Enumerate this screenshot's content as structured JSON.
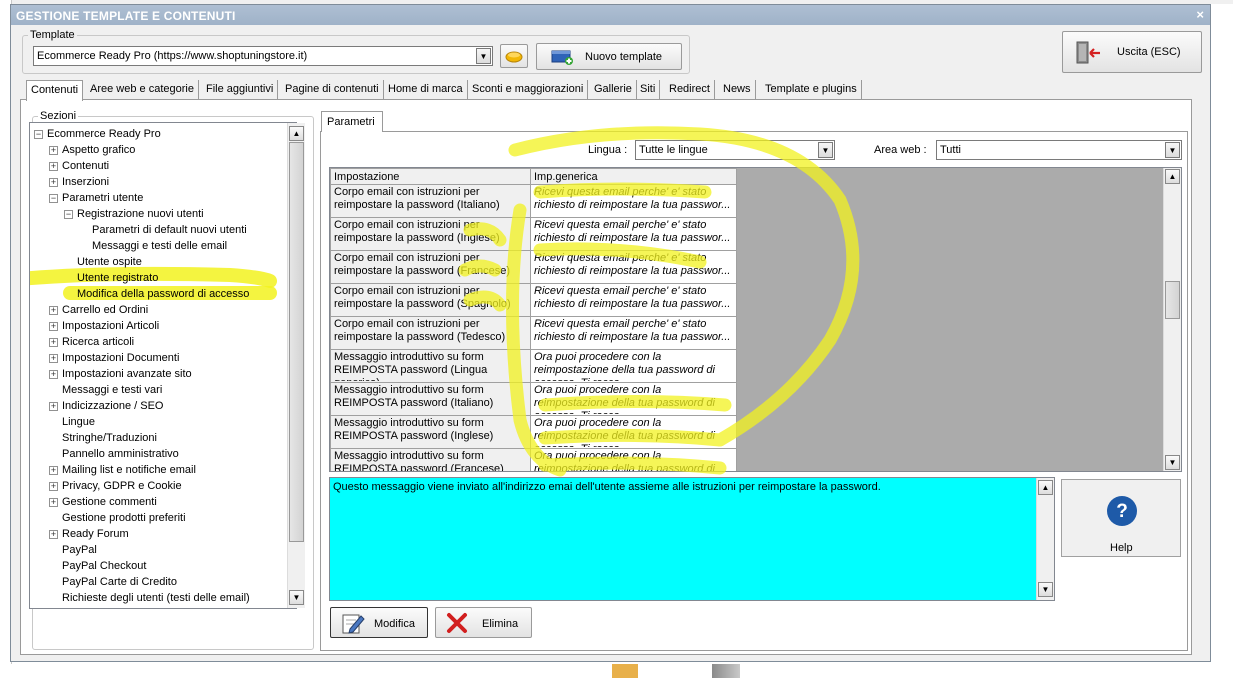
{
  "window": {
    "title": "GESTIONE TEMPLATE E CONTENUTI",
    "close_glyph": "×"
  },
  "template_group": {
    "legend": "Template",
    "selected": "Ecommerce Ready Pro (https://www.shoptuningstore.it)",
    "new_button_label": "Nuovo template"
  },
  "exit_button_label": "Uscita (ESC)",
  "tabs": [
    "Contenuti",
    "Aree web e categorie",
    "File aggiuntivi",
    "Pagine di contenuti",
    "Home di marca",
    "Sconti e maggiorazioni",
    "Gallerie",
    "Siti",
    "Redirect",
    "News",
    "Template e plugins"
  ],
  "active_tab": "Contenuti",
  "sections": {
    "legend": "Sezioni",
    "tree": [
      {
        "label": "Ecommerce Ready Pro",
        "level": 0,
        "expander": "−"
      },
      {
        "label": "Aspetto grafico",
        "level": 1,
        "expander": "+"
      },
      {
        "label": "Contenuti",
        "level": 1,
        "expander": "+"
      },
      {
        "label": "Inserzioni",
        "level": 1,
        "expander": "+"
      },
      {
        "label": "Parametri utente",
        "level": 1,
        "expander": "−"
      },
      {
        "label": "Registrazione nuovi utenti",
        "level": 2,
        "expander": "−"
      },
      {
        "label": "Parametri di default nuovi utenti",
        "level": 3,
        "expander": ""
      },
      {
        "label": "Messaggi e testi delle email",
        "level": 3,
        "expander": ""
      },
      {
        "label": "Utente ospite",
        "level": 2,
        "expander": ""
      },
      {
        "label": "Utente registrato",
        "level": 2,
        "expander": ""
      },
      {
        "label": "Modifica della password di accesso",
        "level": 2,
        "expander": "",
        "selected": true
      },
      {
        "label": "Carrello ed Ordini",
        "level": 1,
        "expander": "+"
      },
      {
        "label": "Impostazioni Articoli",
        "level": 1,
        "expander": "+"
      },
      {
        "label": "Ricerca articoli",
        "level": 1,
        "expander": "+"
      },
      {
        "label": "Impostazioni Documenti",
        "level": 1,
        "expander": "+"
      },
      {
        "label": "Impostazioni avanzate sito",
        "level": 1,
        "expander": "+"
      },
      {
        "label": "Messaggi e testi vari",
        "level": 1,
        "expander": ""
      },
      {
        "label": "Indicizzazione / SEO",
        "level": 1,
        "expander": "+"
      },
      {
        "label": "Lingue",
        "level": 1,
        "expander": ""
      },
      {
        "label": "Stringhe/Traduzioni",
        "level": 1,
        "expander": ""
      },
      {
        "label": "Pannello amministrativo",
        "level": 1,
        "expander": ""
      },
      {
        "label": "Mailing list e notifiche email",
        "level": 1,
        "expander": "+"
      },
      {
        "label": "Privacy, GDPR e Cookie",
        "level": 1,
        "expander": "+"
      },
      {
        "label": "Gestione commenti",
        "level": 1,
        "expander": "+"
      },
      {
        "label": "Gestione prodotti preferiti",
        "level": 1,
        "expander": ""
      },
      {
        "label": "Ready Forum",
        "level": 1,
        "expander": "+"
      },
      {
        "label": "PayPal",
        "level": 1,
        "expander": ""
      },
      {
        "label": "PayPal Checkout",
        "level": 1,
        "expander": ""
      },
      {
        "label": "PayPal Carte di Credito",
        "level": 1,
        "expander": ""
      },
      {
        "label": "Richieste degli utenti (testi delle email)",
        "level": 1,
        "expander": ""
      }
    ]
  },
  "parametri": {
    "tab_label": "Parametri",
    "lingua_label": "Lingua :",
    "lingua_value": "Tutte le lingue",
    "area_label": "Area web :",
    "area_value": "Tutti",
    "columns": [
      "Impostazione",
      "Imp.generica"
    ],
    "rows": [
      [
        "Corpo email con istruzioni per reimpostare la password (Italiano)",
        "Ricevi questa email perche' e' stato richiesto di reimpostare la tua passwor..."
      ],
      [
        "Corpo email con istruzioni per reimpostare la password (Inglese)",
        "Ricevi questa email perche' e' stato richiesto di reimpostare la tua passwor..."
      ],
      [
        "Corpo email con istruzioni per reimpostare la password (Francese)",
        "Ricevi questa email perche' e' stato richiesto di reimpostare la tua passwor..."
      ],
      [
        "Corpo email con istruzioni per reimpostare la password (Spagnolo)",
        "Ricevi questa email perche' e' stato richiesto di reimpostare la tua passwor..."
      ],
      [
        "Corpo email con istruzioni per reimpostare la password (Tedesco)",
        "Ricevi questa email perche' e' stato richiesto di reimpostare la tua passwor..."
      ],
      [
        "Messaggio introduttivo su form REIMPOSTA password (Lingua generica)",
        "Ora puoi procedere con la reimpostazione della tua password di accesso. Ti racco..."
      ],
      [
        "Messaggio introduttivo su form REIMPOSTA password (Italiano)",
        "Ora puoi procedere con la reimpostazione della tua password di accesso. Ti racco..."
      ],
      [
        "Messaggio introduttivo su form REIMPOSTA password (Inglese)",
        "Ora puoi procedere con la reimpostazione della tua password di accesso. Ti racco..."
      ],
      [
        "Messaggio introduttivo su form REIMPOSTA password (Francese)",
        "Ora puoi procedere con la reimpostazione della tua password di accesso. Ti racco..."
      ]
    ],
    "description": "Questo messaggio viene inviato all'indirizzo emai dell'utente assieme alle istruzioni per reimpostare la password.",
    "help_label": "Help",
    "modifica_label": "Modifica",
    "elimina_label": "Elimina"
  },
  "colors": {
    "highlight": "#f2f21f",
    "memo_bg": "#00ffff",
    "titlebar": "#9fb2c8",
    "help_blue": "#1e5aa8"
  }
}
